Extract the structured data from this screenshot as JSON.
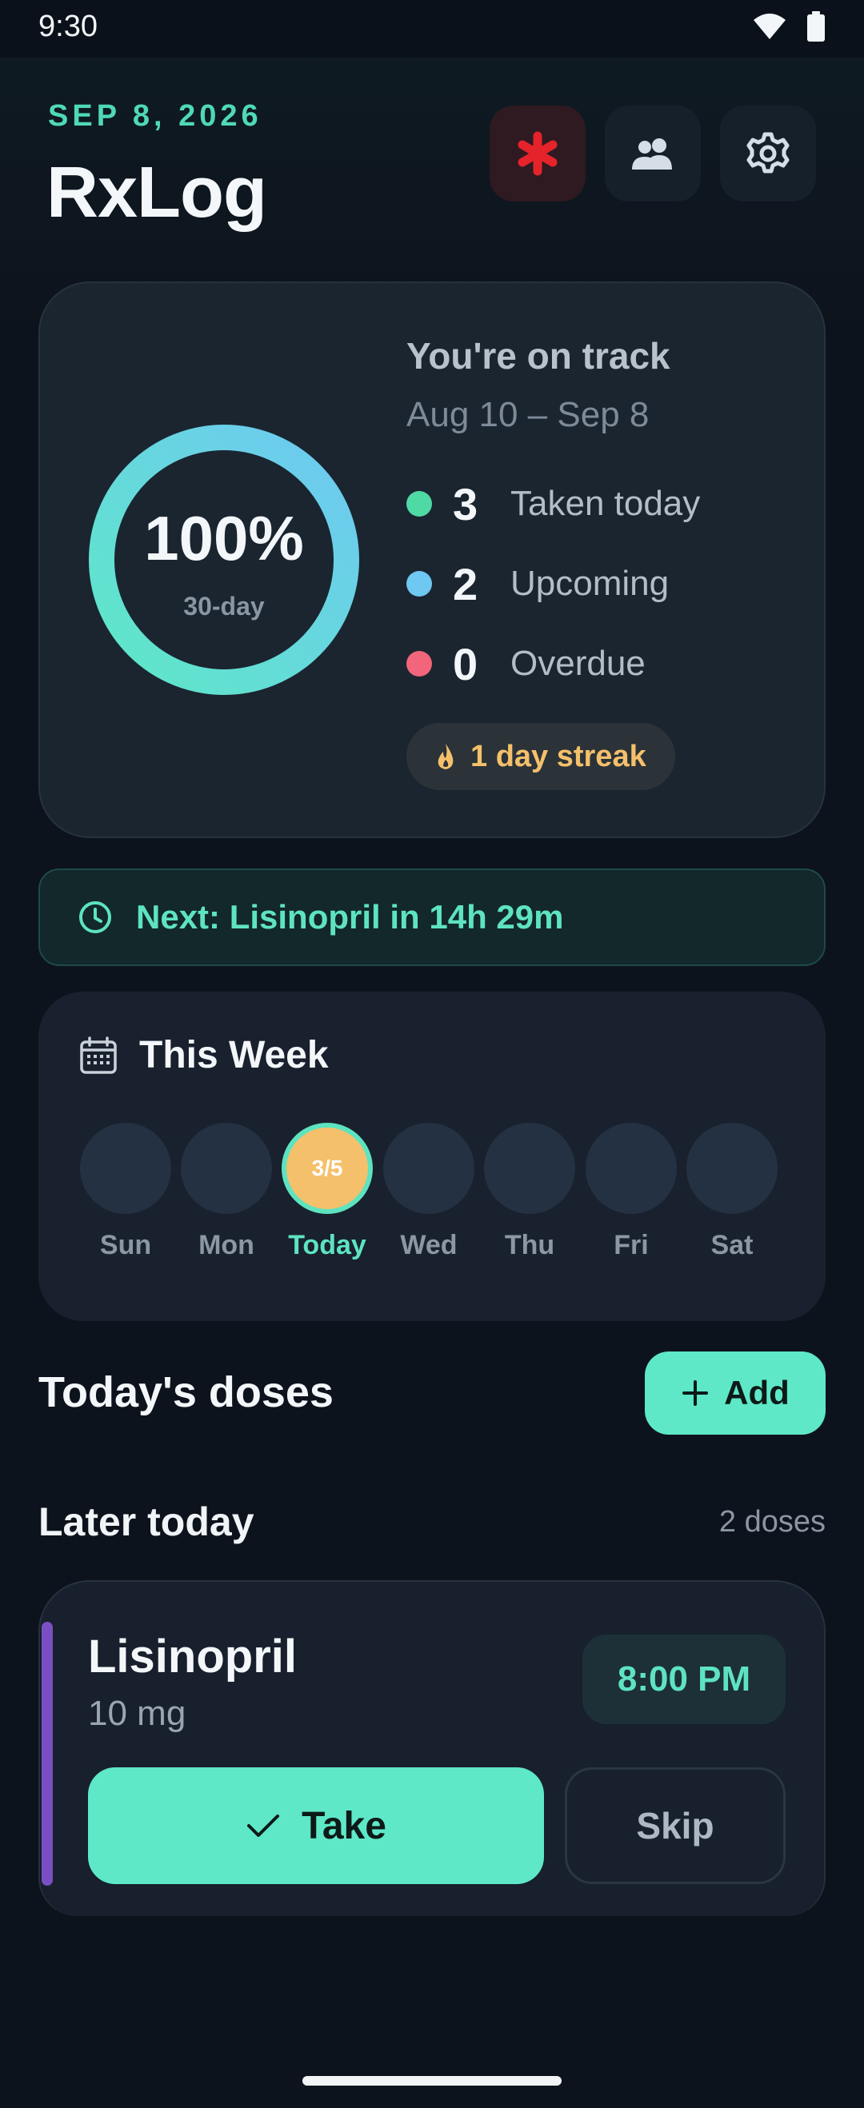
{
  "status_bar": {
    "time": "9:30"
  },
  "header": {
    "date": "SEP 8, 2026",
    "title": "RxLog",
    "buttons": {
      "emergency_icon": "asterisk-icon",
      "caregivers_icon": "people-icon",
      "settings_icon": "gear-icon"
    }
  },
  "summary": {
    "adherence_percent": "100%",
    "adherence_percent_value": 1.0,
    "period_label": "30-day",
    "title": "You're on track",
    "range": "Aug 10 – Sep 8",
    "stats": [
      {
        "count": "3",
        "label": "Taken today",
        "color": "#4fd9a5"
      },
      {
        "count": "2",
        "label": "Upcoming",
        "color": "#6ec8f2"
      },
      {
        "count": "0",
        "label": "Overdue",
        "color": "#f2657a"
      }
    ],
    "streak": "1 day streak"
  },
  "next_banner": {
    "text": "Next: Lisinopril in 14h 29m"
  },
  "week": {
    "title": "This Week",
    "days": [
      {
        "label": "Sun",
        "value": ""
      },
      {
        "label": "Mon",
        "value": ""
      },
      {
        "label": "Today",
        "value": "3/5"
      },
      {
        "label": "Wed",
        "value": ""
      },
      {
        "label": "Thu",
        "value": ""
      },
      {
        "label": "Fri",
        "value": ""
      },
      {
        "label": "Sat",
        "value": ""
      }
    ]
  },
  "doses": {
    "title": "Today's doses",
    "add_label": "Add",
    "later_title": "Later today",
    "later_count": "2 doses",
    "items": [
      {
        "name": "Lisinopril",
        "amount": "10 mg",
        "time": "8:00 PM",
        "take_label": "Take",
        "skip_label": "Skip",
        "accent": "#7b4fc4"
      }
    ]
  },
  "colors": {
    "accent": "#5ee8c7",
    "background": "#0d131c",
    "card": "#1a2530"
  }
}
